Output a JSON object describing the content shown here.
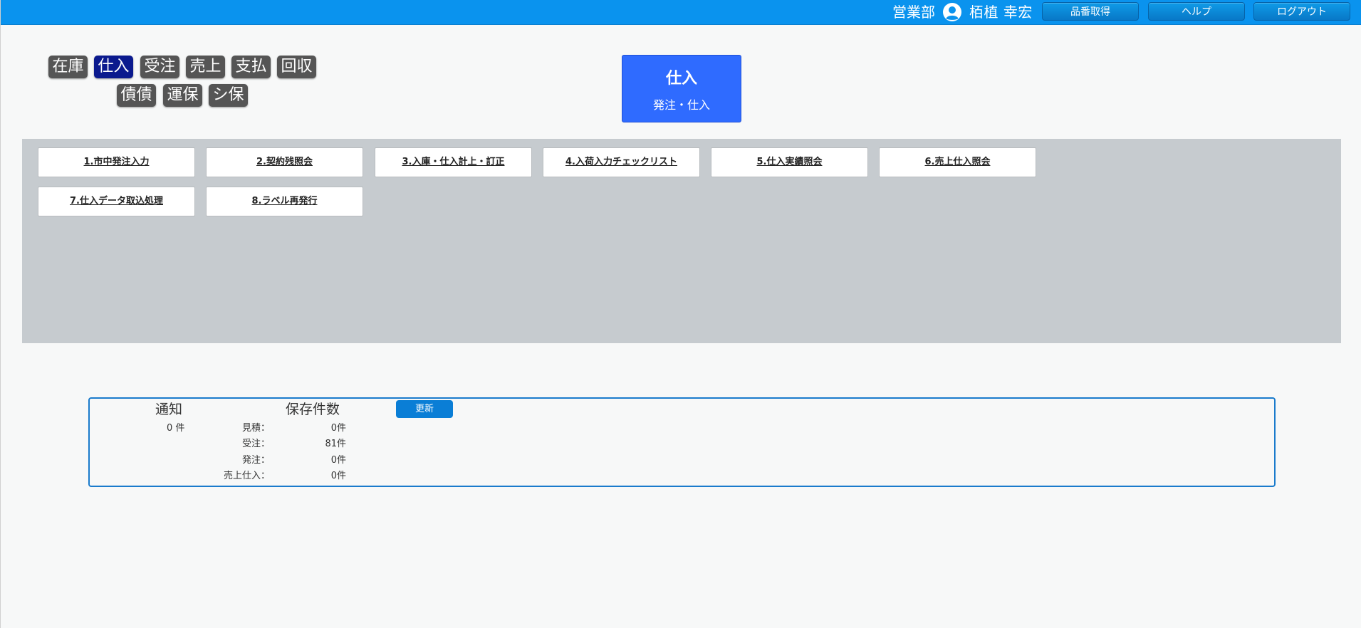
{
  "header": {
    "department": "営業部",
    "user_name": "栢植 幸宏",
    "buttons": [
      "品番取得",
      "ヘルプ",
      "ログアウト"
    ]
  },
  "categories": {
    "row1": [
      "在庫",
      "仕入",
      "受注",
      "売上",
      "支払",
      "回収"
    ],
    "row2": [
      "債債",
      "運保",
      "シ保"
    ],
    "active": "仕入"
  },
  "section": {
    "title": "仕入",
    "subtitle": "発注・仕入"
  },
  "menu": {
    "items": [
      "1.市中発注入力",
      "2.契約残照会",
      "3.入庫・仕入計上・訂正",
      "4.入荷入力チェックリスト",
      "5.仕入実績照会",
      "6.売上仕入照会",
      "7.仕入データ取込処理",
      "8.ラベル再発行"
    ]
  },
  "info": {
    "notice_title": "通知",
    "notice_count": "0 件",
    "saved_title": "保存件数",
    "refresh_label": "更新",
    "saved_counts": [
      {
        "label": "見積：",
        "value": "0件"
      },
      {
        "label": "受注：",
        "value": "81件"
      },
      {
        "label": "発注：",
        "value": "0件"
      },
      {
        "label": "売上仕入：",
        "value": "0件"
      }
    ]
  },
  "colors": {
    "topbar": "#0a93ee",
    "active_category": "#0b1a8e",
    "category": "#555555",
    "section_box": "#2f6bff",
    "menu_area": "#c6cbcf",
    "panel_border": "#1a7bcc"
  },
  "icons": {
    "user": "user-circle-icon"
  }
}
